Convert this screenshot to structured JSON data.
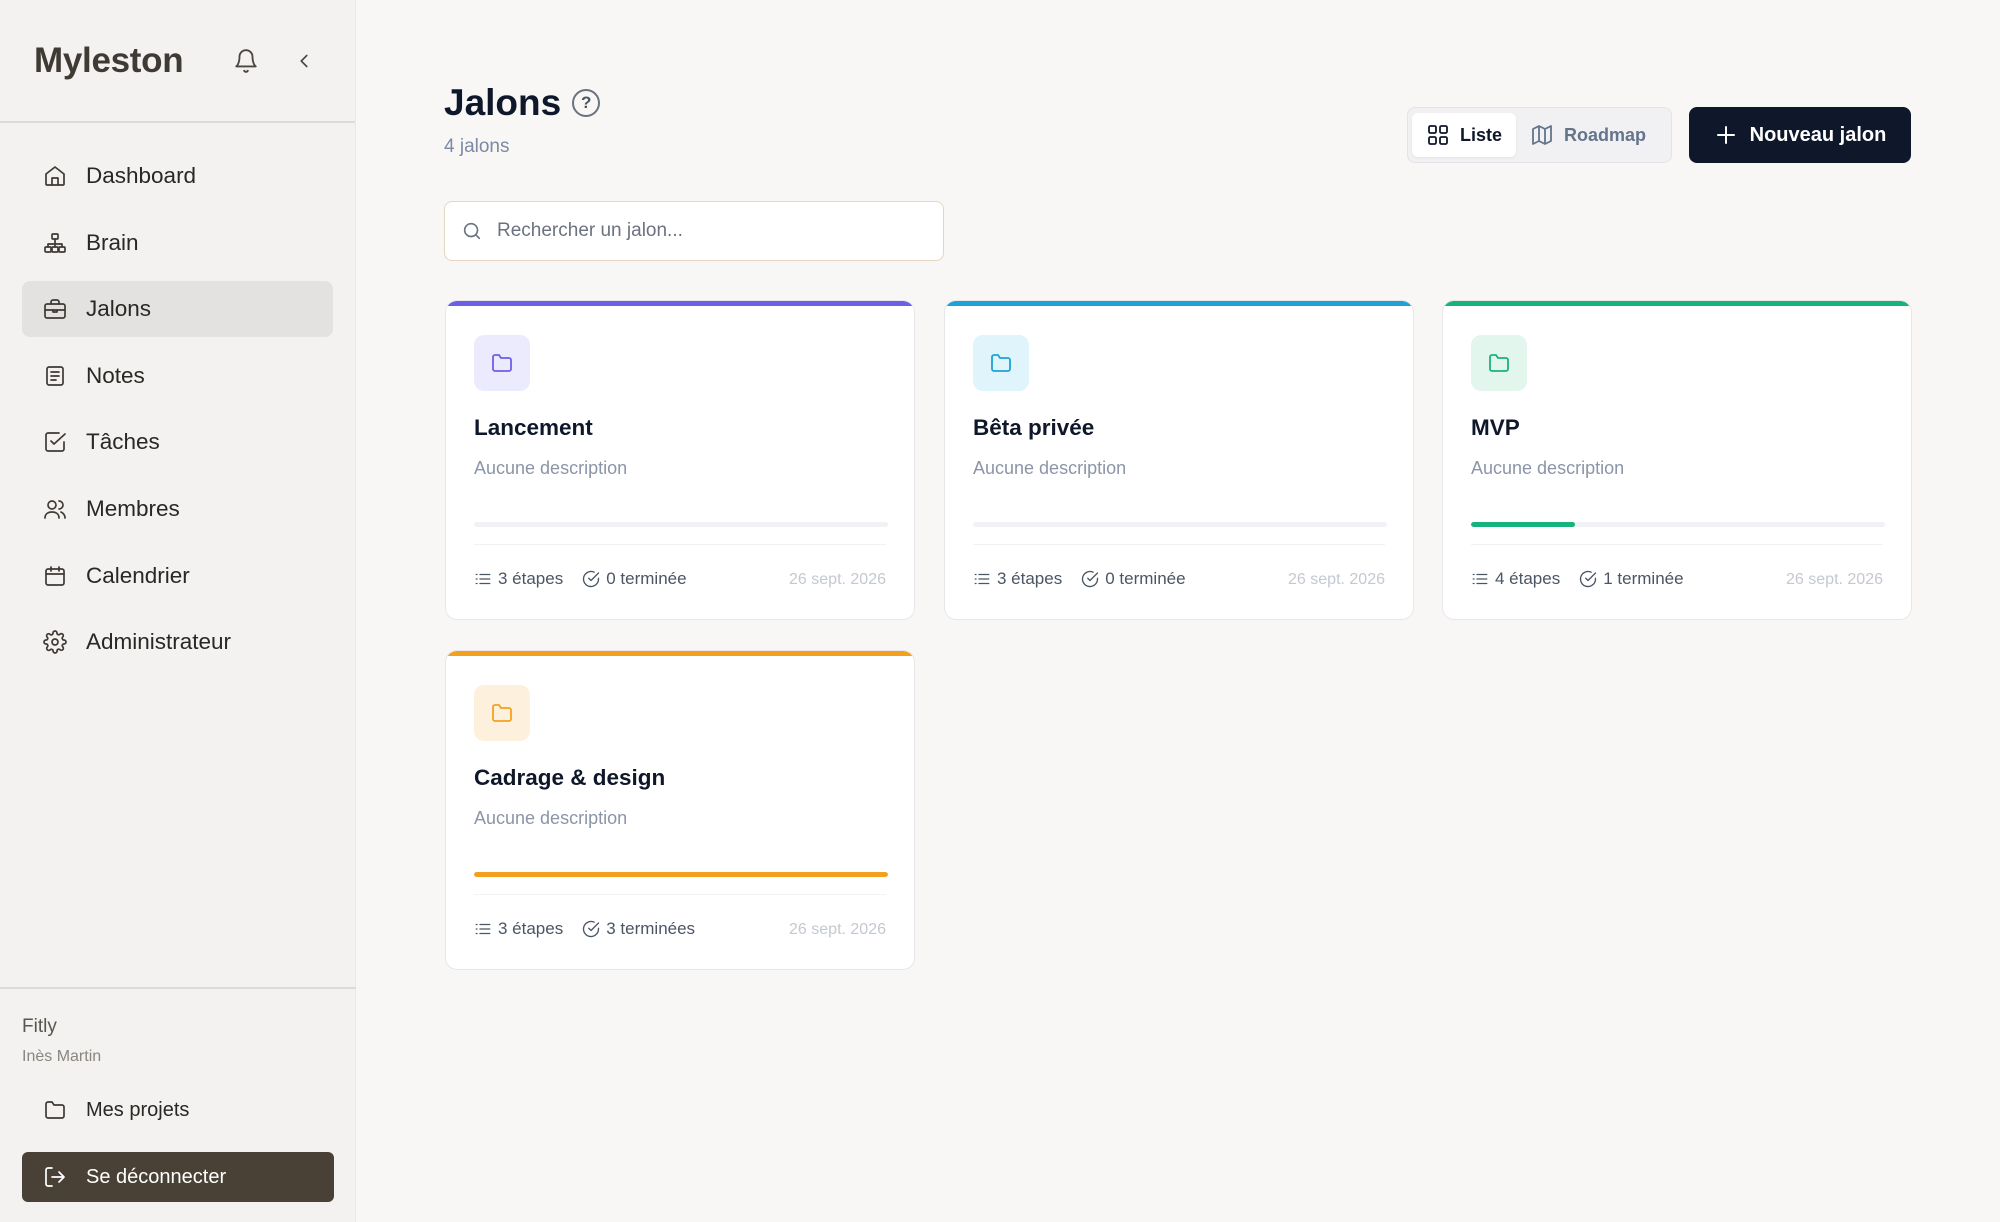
{
  "app": {
    "brand": "Myleston"
  },
  "sidebar": {
    "items": [
      {
        "label": "Dashboard",
        "icon": "home-icon",
        "active": false
      },
      {
        "label": "Brain",
        "icon": "hierarchy-icon",
        "active": false
      },
      {
        "label": "Jalons",
        "icon": "briefcase-icon",
        "active": true
      },
      {
        "label": "Notes",
        "icon": "document-icon",
        "active": false
      },
      {
        "label": "Tâches",
        "icon": "checkbox-icon",
        "active": false
      },
      {
        "label": "Membres",
        "icon": "users-icon",
        "active": false
      },
      {
        "label": "Calendrier",
        "icon": "calendar-icon",
        "active": false
      },
      {
        "label": "Administrateur",
        "icon": "gear-icon",
        "active": false
      }
    ],
    "footer": {
      "org": "Fitly",
      "user": "Inès Martin",
      "projects_label": "Mes projets",
      "logout_label": "Se déconnecter"
    }
  },
  "header": {
    "title": "Jalons",
    "help": "?",
    "count": "4 jalons",
    "view_list": "Liste",
    "view_roadmap": "Roadmap",
    "new_button": "Nouveau jalon"
  },
  "search": {
    "placeholder": "Rechercher un jalon...",
    "value": ""
  },
  "cards": [
    {
      "title": "Lancement",
      "description": "Aucune description",
      "steps": "3 étapes",
      "done": "0 terminée",
      "date": "26 sept. 2026",
      "color": "#6d5ee8",
      "icon_bg": "#ecebfd",
      "progress": 0
    },
    {
      "title": "Bêta privée",
      "description": "Aucune description",
      "steps": "3 étapes",
      "done": "0 terminée",
      "date": "26 sept. 2026",
      "color": "#1ba3d6",
      "icon_bg": "#e0f4fb",
      "progress": 0
    },
    {
      "title": "MVP",
      "description": "Aucune description",
      "steps": "4 étapes",
      "done": "1 terminée",
      "date": "26 sept. 2026",
      "color": "#16b37c",
      "icon_bg": "#e2f6ee",
      "progress": 0.25
    },
    {
      "title": "Cadrage & design",
      "description": "Aucune description",
      "steps": "3 étapes",
      "done": "3 terminées",
      "date": "26 sept. 2026",
      "color": "#f4a01f",
      "icon_bg": "#fdf0dc",
      "progress": 1
    }
  ]
}
